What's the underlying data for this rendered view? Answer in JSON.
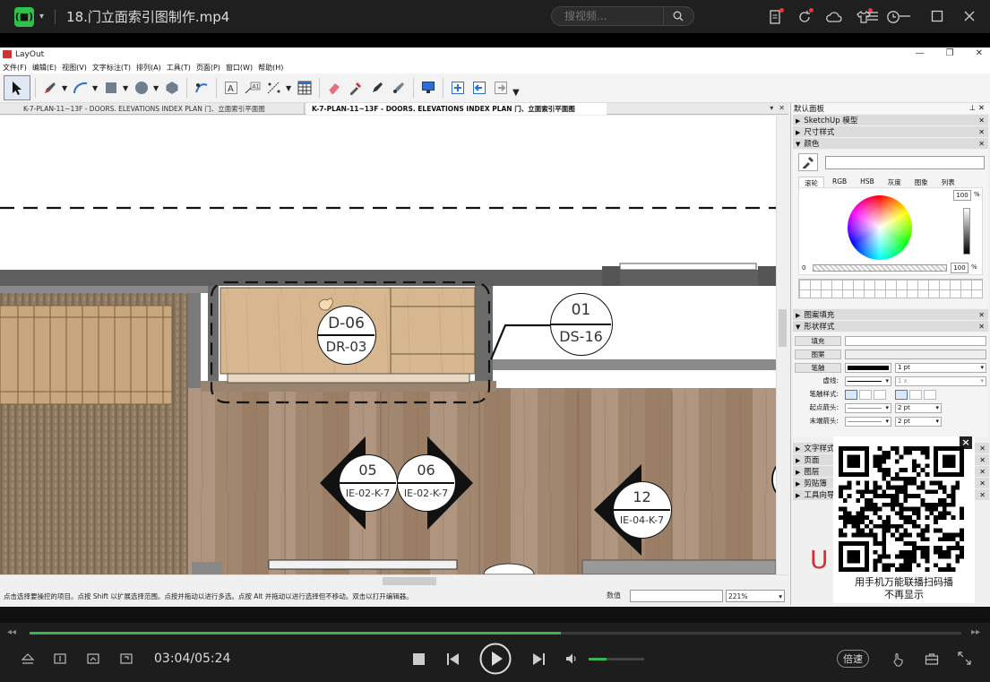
{
  "player": {
    "logo": "(■)",
    "title": "18.门立面索引图制作.mp4",
    "search_placeholder": "搜视频...",
    "current_time": "03:04",
    "duration": "05:24",
    "time_display": "03:04/05:24",
    "progress_fraction": 0.57,
    "volume_fraction": 0.33,
    "speed_label": "倍速"
  },
  "layout": {
    "app_title": "LayOut",
    "menu": [
      "文件(F)",
      "编辑(E)",
      "视图(V)",
      "文字标注(T)",
      "排列(A)",
      "工具(T)",
      "页面(P)",
      "窗口(W)",
      "帮助(H)"
    ],
    "tabs": [
      {
        "label": "K-7-PLAN-11~13F - DOORS. ELEVATIONS INDEX PLAN 门、立面索引平面图",
        "active": false
      },
      {
        "label": "K-7-PLAN-11~13F - DOORS. ELEVATIONS INDEX PLAN 门、立面索引平面图",
        "active": true
      }
    ],
    "status_text": "点击选择要操控的项目。点按 Shift 以扩展选择范围。点按并拖动以进行多选。点按 Alt 并拖动以进行选择但不移动。双击以打开编辑器。",
    "measure_label": "数值",
    "zoom_value": "221%"
  },
  "canvas": {
    "tag_door": {
      "top": "D-06",
      "bottom": "DR-03"
    },
    "tag_ds": {
      "top": "01",
      "bottom": "DS-16"
    },
    "tag_05": {
      "top": "05",
      "bottom": "IE-02-K-7"
    },
    "tag_06": {
      "top": "06",
      "bottom": "IE-02-K-7"
    },
    "tag_12": {
      "top": "12",
      "bottom": "IE-04-K-7"
    }
  },
  "panel": {
    "title": "默认面板",
    "pin": "ᵖ",
    "sections_top": [
      "SketchUp 模型",
      "尺寸样式",
      "颜色"
    ],
    "color_tabs": [
      "滚轮",
      "RGB",
      "HSB",
      "灰度",
      "图象",
      "列表"
    ],
    "brightness": "100",
    "opacity": "100",
    "percent": "%",
    "opacity_min": "0",
    "sections_mid": [
      "图案填充",
      "形状样式"
    ],
    "shape": {
      "fill_label": "填充",
      "pattern_label": "图案",
      "stroke_label": "笔触",
      "stroke_width": "1 pt",
      "dash_label": "虚线:",
      "dash_scale": "1 x",
      "pen_label": "笔触样式:",
      "start_arrow_label": "起点箭头:",
      "start_arrow_size": "2 pt",
      "end_arrow_label": "末端箭头:",
      "end_arrow_size": "2 pt"
    },
    "sections_bottom": [
      "文字样式",
      "页面",
      "图层",
      "剪贴簿",
      "工具向导"
    ]
  },
  "qr": {
    "close": "×",
    "caption_line1": "用手机万能联播扫码播",
    "caption_line2": "不再显示",
    "brand_letter": "U"
  },
  "colors": {
    "accent": "#39b54a",
    "notify_dot": "#e33333"
  }
}
